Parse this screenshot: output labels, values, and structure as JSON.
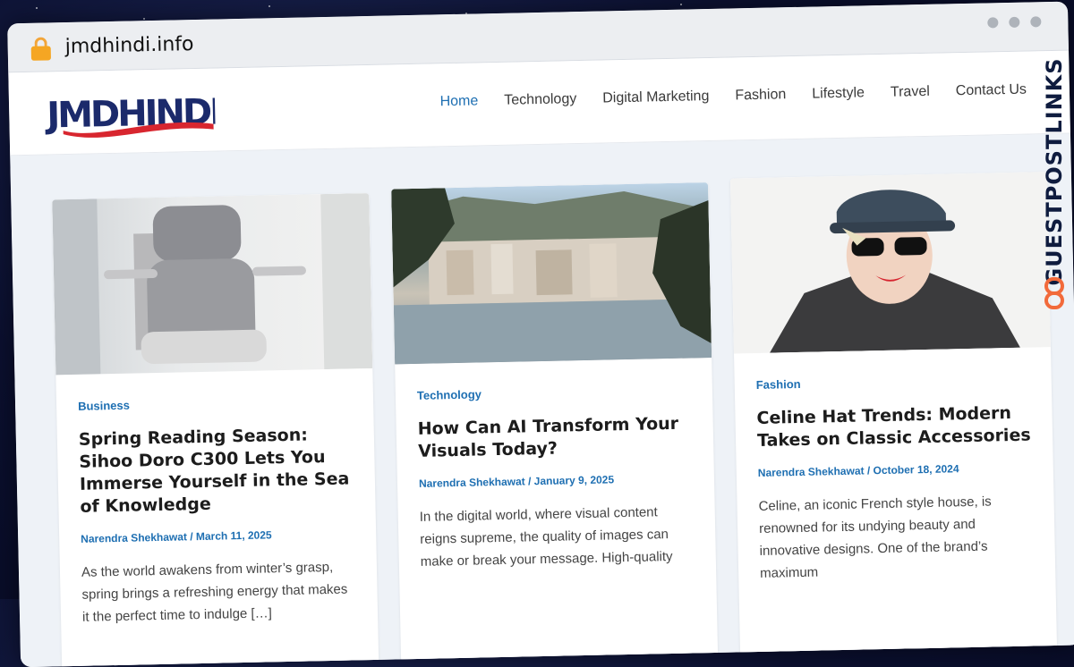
{
  "browser": {
    "url": "jmdhindi.info"
  },
  "site": {
    "logo_text": "JMDHINDI",
    "nav": [
      {
        "label": "Home",
        "active": true
      },
      {
        "label": "Technology"
      },
      {
        "label": "Digital Marketing"
      },
      {
        "label": "Fashion"
      },
      {
        "label": "Lifestyle"
      },
      {
        "label": "Travel"
      },
      {
        "label": "Contact Us"
      }
    ]
  },
  "posts": [
    {
      "category": "Business",
      "title": "Spring Reading Season: Sihoo Doro C300 Lets You Immerse Yourself in the Sea of Knowledge",
      "meta": "Narendra Shekhawat / March 11, 2025",
      "excerpt": "As the world awakens from winter’s grasp, spring brings a refreshing energy that makes it the perfect time to indulge […]"
    },
    {
      "category": "Technology",
      "title": "How Can AI Transform Your Visuals Today?",
      "meta": "Narendra Shekhawat / January 9, 2025",
      "excerpt": "In the digital world, where visual content reigns supreme, the quality of images can make or break your message. High-quality"
    },
    {
      "category": "Fashion",
      "title": "Celine Hat Trends: Modern Takes on Classic Accessories",
      "meta": "Narendra Shekhawat / October 18, 2024",
      "excerpt": "Celine, an iconic French style house, is renowned for its undying beauty and innovative designs. One of the brand’s maximum"
    }
  ],
  "watermark": {
    "text": "GUESTPOSTLINKS"
  },
  "colors": {
    "accent": "#1e6fb2",
    "logo_navy": "#1b2a6b",
    "logo_red": "#d8262f"
  }
}
